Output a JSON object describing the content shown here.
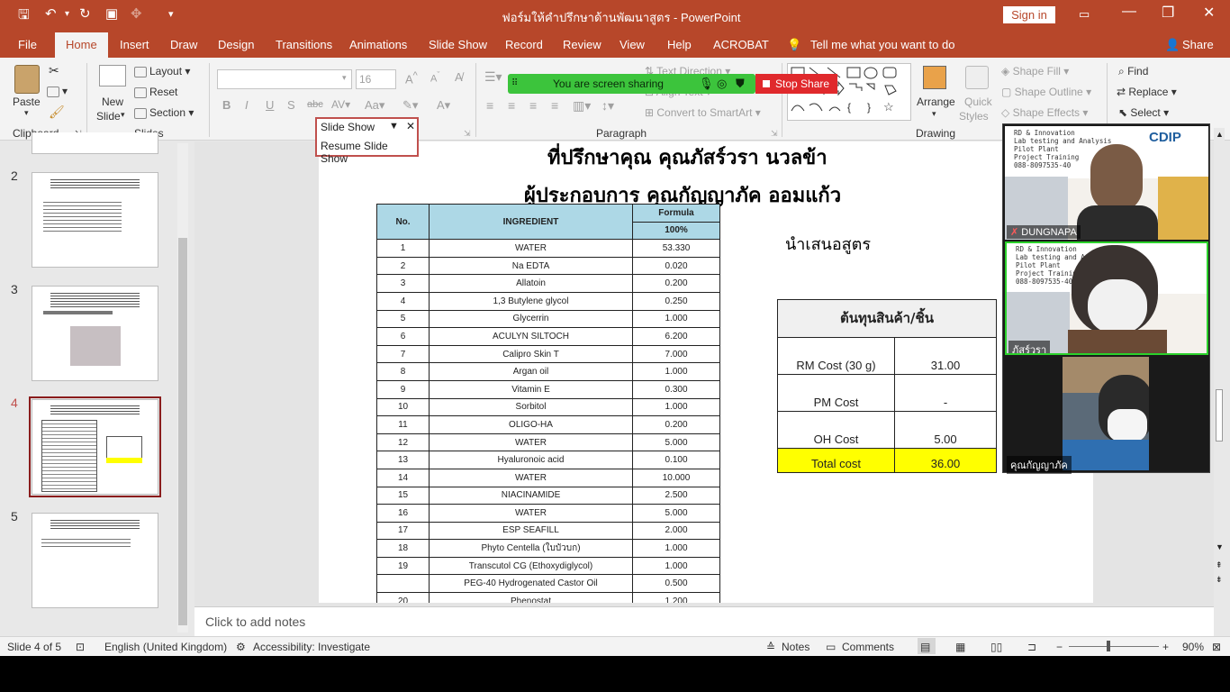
{
  "window": {
    "title": "ฟอร์มให้คำปรึกษาด้านพัฒนาสูตร - PowerPoint",
    "sign_in": "Sign in"
  },
  "tabs": [
    "File",
    "Home",
    "Insert",
    "Draw",
    "Design",
    "Transitions",
    "Animations",
    "Slide Show",
    "Record",
    "Review",
    "View",
    "Help",
    "ACROBAT"
  ],
  "tell_me": "Tell me what you want to do",
  "share": "Share",
  "ribbon": {
    "paste": "Paste",
    "new_slide_1": "New",
    "new_slide_2": "Slide",
    "layout": "Layout",
    "reset": "Reset",
    "section": "Section",
    "font_size": "16",
    "text_direction": "Text Direction",
    "align_text": "Align Text",
    "convert_smartart": "Convert to SmartArt",
    "arrange": "Arrange",
    "quick_styles_1": "Quick",
    "quick_styles_2": "Styles",
    "shape_fill": "Shape Fill",
    "shape_outline": "Shape Outline",
    "shape_effects": "Shape Effects",
    "find": "Find",
    "replace": "Replace",
    "select": "Select",
    "groups": {
      "clipboard": "Clipboard",
      "slides": "Slides",
      "paragraph": "Paragraph",
      "drawing": "Drawing"
    }
  },
  "screen_share": {
    "message": "You are screen sharing",
    "stop": "Stop Share"
  },
  "slideshow_menu": {
    "title": "Slide Show",
    "resume": "Resume Slide Show"
  },
  "thumbnails": [
    {
      "num": "2"
    },
    {
      "num": "3"
    },
    {
      "num": "4"
    },
    {
      "num": "5"
    }
  ],
  "slide": {
    "line1": "ที่ปรึกษาคุณ คุณภัสร์วรา นวลข้า",
    "line2": "ผู้ประกอบการ คุณกัญญาภัค ออมแก้ว",
    "present": "นำเสนอสูตร",
    "table": {
      "h_no": "No.",
      "h_ing": "INGREDIENT",
      "h_formula": "Formula",
      "h_pct": "100%",
      "rows": [
        [
          "1",
          "WATER",
          "53.330"
        ],
        [
          "2",
          "Na EDTA",
          "0.020"
        ],
        [
          "3",
          "Allatoin",
          "0.200"
        ],
        [
          "4",
          "1,3 Butylene glycol",
          "0.250"
        ],
        [
          "5",
          "Glycerrin",
          "1.000"
        ],
        [
          "6",
          "ACULYN SILTOCH",
          "6.200"
        ],
        [
          "7",
          "Calipro Skin T",
          "7.000"
        ],
        [
          "8",
          "Argan oil",
          "1.000"
        ],
        [
          "9",
          "Vitamin E",
          "0.300"
        ],
        [
          "10",
          "Sorbitol",
          "1.000"
        ],
        [
          "11",
          "OLIGO-HA",
          "0.200"
        ],
        [
          "12",
          "WATER",
          "5.000"
        ],
        [
          "13",
          "Hyaluronoic acid",
          "0.100"
        ],
        [
          "14",
          "WATER",
          "10.000"
        ],
        [
          "15",
          "NIACINAMIDE",
          "2.500"
        ],
        [
          "16",
          "WATER",
          "5.000"
        ],
        [
          "17",
          "ESP SEAFILL",
          "2.000"
        ],
        [
          "18",
          "Phyto Centella (ใบบัวบก)",
          "1.000"
        ],
        [
          "19",
          "Transcutol CG (Ethoxydiglycol)",
          "1.000"
        ],
        [
          "",
          "PEG-40 Hydrogenated Castor Oil",
          "0.500"
        ],
        [
          "20",
          "Phenostat",
          "1.200"
        ]
      ]
    },
    "cost": {
      "title": "ต้นทุนสินค้า/ชิ้น",
      "rm_label": "RM Cost (30 g)",
      "rm_value": "31.00",
      "pm_label": "PM Cost",
      "pm_value": "-",
      "oh_label": "OH Cost",
      "oh_value": "5.00",
      "total_label": "Total cost",
      "total_value": "36.00",
      "highlight": "#ffff00"
    }
  },
  "notes_placeholder": "Click to add notes",
  "video": {
    "names": [
      "DUNGNAPA",
      "ภัสร์วรา",
      "คุณกัญญาภัค"
    ],
    "banner": {
      "logo": "CDIP",
      "lines": [
        "RD & Innovation",
        "Lab testing and Analysis",
        "Pilot Plant",
        "Project Training"
      ],
      "phone": "088-8097535-40"
    }
  },
  "status": {
    "slide": "Slide 4 of 5",
    "language": "English (United Kingdom)",
    "accessibility": "Accessibility: Investigate",
    "notes": "Notes",
    "comments": "Comments",
    "zoom": "90%"
  },
  "colors": {
    "accent": "#b7472a"
  }
}
